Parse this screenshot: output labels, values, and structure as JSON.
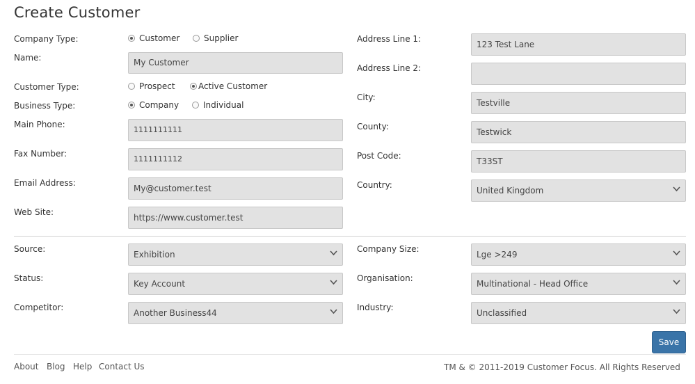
{
  "page": {
    "title": "Create Customer"
  },
  "left": {
    "company_type": {
      "label": "Company Type:",
      "options": [
        {
          "label": "Customer",
          "selected": true
        },
        {
          "label": "Supplier",
          "selected": false
        }
      ]
    },
    "name": {
      "label": "Name:",
      "value": "My Customer"
    },
    "customer_type": {
      "label": "Customer Type:",
      "options": [
        {
          "label": "Prospect",
          "selected": false
        },
        {
          "label": "Active Customer",
          "selected": true
        }
      ]
    },
    "business_type": {
      "label": "Business Type:",
      "options": [
        {
          "label": "Company",
          "selected": true
        },
        {
          "label": "Individual",
          "selected": false
        }
      ]
    },
    "main_phone": {
      "label": "Main Phone:",
      "value": "1111111111"
    },
    "fax_number": {
      "label": "Fax Number:",
      "value": "1111111112"
    },
    "email": {
      "label": "Email Address:",
      "value": "My@customer.test"
    },
    "web_site": {
      "label": "Web Site:",
      "value": "https://www.customer.test"
    }
  },
  "right": {
    "address1": {
      "label": "Address Line 1:",
      "value": "123 Test Lane"
    },
    "address2": {
      "label": "Address Line 2:",
      "value": ""
    },
    "city": {
      "label": "City:",
      "value": "Testville"
    },
    "county": {
      "label": "County:",
      "value": "Testwick"
    },
    "post_code": {
      "label": "Post Code:",
      "value": "T33ST"
    },
    "country": {
      "label": "Country:",
      "value": "United Kingdom"
    }
  },
  "lower_left": {
    "source": {
      "label": "Source:",
      "value": "Exhibition"
    },
    "status": {
      "label": "Status:",
      "value": "Key Account"
    },
    "competitor": {
      "label": "Competitor:",
      "value": "Another Business44"
    }
  },
  "lower_right": {
    "company_size": {
      "label": "Company Size:",
      "value": "Lge >249"
    },
    "organisation": {
      "label": "Organisation:",
      "value": "Multinational - Head Office"
    },
    "industry": {
      "label": "Industry:",
      "value": "Unclassified"
    }
  },
  "actions": {
    "save_label": "Save"
  },
  "footer": {
    "links": [
      "About",
      "Blog",
      "Help",
      "Contact Us"
    ],
    "copyright": "TM & © 2011-2019 Customer Focus. All Rights Reserved"
  },
  "colors": {
    "accent": "#3a74a8",
    "field_bg": "#e2e2e2"
  },
  "icons": {
    "select_arrow": "chevron-down-icon"
  }
}
